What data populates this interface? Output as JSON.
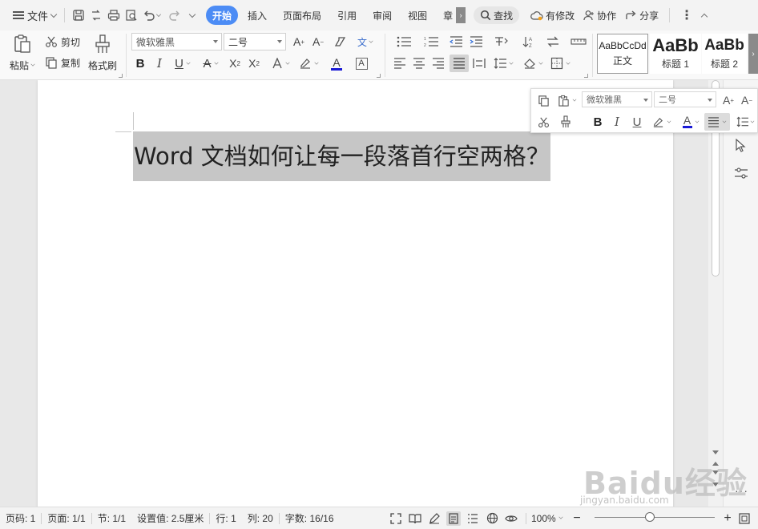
{
  "menu": {
    "file_label": "文件",
    "tabs": [
      {
        "label": "开始",
        "active": true
      },
      {
        "label": "插入",
        "active": false
      },
      {
        "label": "页面布局",
        "active": false
      },
      {
        "label": "引用",
        "active": false
      },
      {
        "label": "审阅",
        "active": false
      },
      {
        "label": "视图",
        "active": false
      },
      {
        "label": "章",
        "active": false
      }
    ],
    "search_label": "查找",
    "has_changes_label": "有修改",
    "collab_label": "协作",
    "share_label": "分享"
  },
  "ribbon": {
    "paste_label": "粘贴",
    "cut_label": "剪切",
    "copy_label": "复制",
    "format_painter_label": "格式刷",
    "font_name": "微软雅黑",
    "font_size": "二号",
    "styles": [
      {
        "preview": "AaBbCcDd",
        "label": "正文"
      },
      {
        "preview": "AaBb",
        "label": "标题 1"
      },
      {
        "preview": "AaBb",
        "label": "标题 2"
      }
    ],
    "accent_color": "#4c8cf5",
    "font_color_bar": "#1a1ad6"
  },
  "mini_toolbar": {
    "font_name": "微软雅黑",
    "font_size": "二号"
  },
  "document": {
    "heading": "Word 文档如何让每一段落首行空两格？"
  },
  "status": {
    "page_num": "页码: 1",
    "pages": "页面: 1/1",
    "section": "节: 1/1",
    "setting": "设置值: 2.5厘米",
    "row": "行: 1",
    "col": "列: 20",
    "wordcount": "字数: 16/16",
    "zoom": "100%"
  },
  "watermark": {
    "text": "Baidu经验",
    "url": "jingyan.baidu.com"
  }
}
